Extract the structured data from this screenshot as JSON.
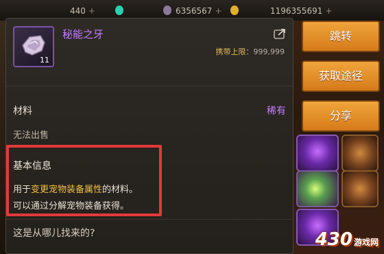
{
  "hud": {
    "resource1": "440",
    "resource2": "6356567",
    "resource3": "1196355691",
    "plus": "+"
  },
  "item": {
    "name": "秘能之牙",
    "count": "11",
    "carry_label": "携带上限：",
    "carry_value": "999,999",
    "category": "材料",
    "rarity": "稀有",
    "sell_status": "无法出售",
    "basic_info_title": "基本信息",
    "desc_prefix": "用于",
    "desc_highlight": "变更宠物装备属性",
    "desc_suffix": "的材料。",
    "desc_line2": "可以通过分解宠物装备获得。",
    "where_text": "这是从哪儿找来的?"
  },
  "buttons": {
    "jump": "跳转",
    "obtain": "获取途径",
    "share": "分享"
  },
  "watermark": {
    "main": "430",
    "sub": "游戏网"
  },
  "colors": {
    "item_name": "#c77cff",
    "rarity": "#c77cff",
    "highlight_text": "#f0c040",
    "carry_label": "#e0b860",
    "button": "#e8952e",
    "highlight_box": "#e23a3a"
  }
}
